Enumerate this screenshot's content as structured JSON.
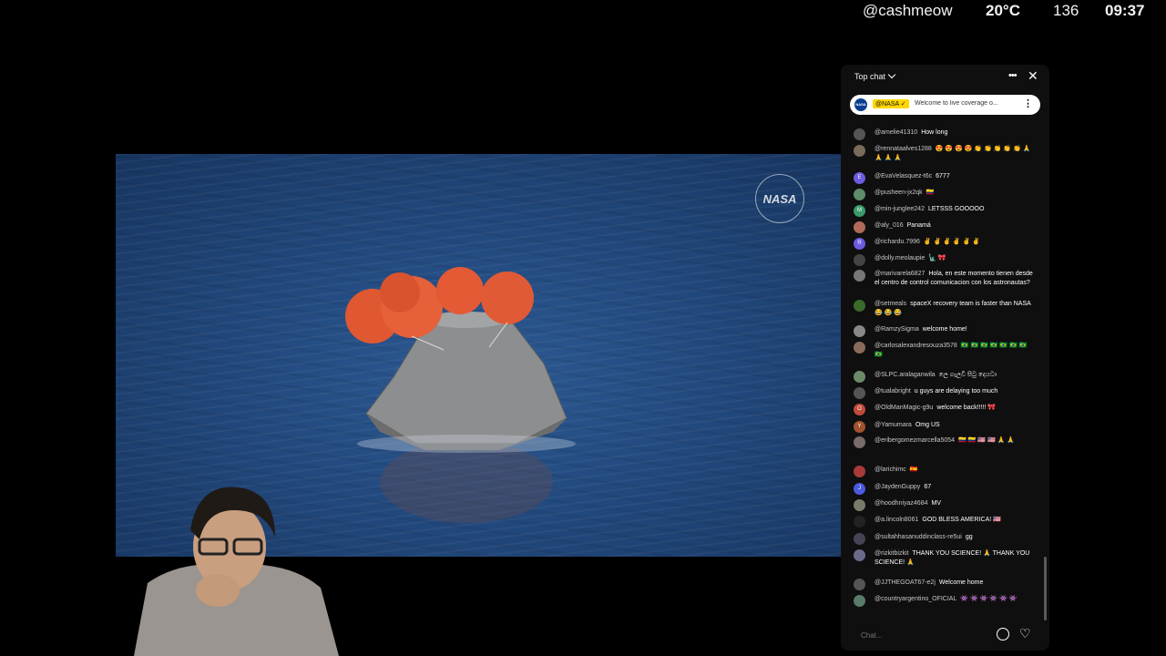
{
  "overlay": {
    "handle": "@cashmeow",
    "temperature": "20°C",
    "count": "136",
    "time": "09:37"
  },
  "video": {
    "logo": "NASA"
  },
  "chat": {
    "title": "Top chat",
    "pinned": {
      "author": "@NASA ✓",
      "text": "Welcome to live coverage o..."
    },
    "input_placeholder": "Chat...",
    "messages": [
      {
        "author": "@amelie41310",
        "text": "How long",
        "avatar": ""
      },
      {
        "author": "@rennataalves1288",
        "text": "😍 😍 😍 😍 👏 👏 👏 👏 👏 🙏 🙏 🙏 🙏",
        "avatar": ""
      },
      {
        "author": "@EvaVelasquez-t6c",
        "text": "6777",
        "avatar": "E"
      },
      {
        "author": "@pusheen-jx2qk",
        "text": "🇨🇴",
        "avatar": ""
      },
      {
        "author": "@min-junglee242",
        "text": "LETSSS GOOOOO",
        "avatar": "M"
      },
      {
        "author": "@aly_016",
        "text": "Panamá",
        "avatar": ""
      },
      {
        "author": "@richardu.7996",
        "text": "✌ ✌ ✌ ✌ ✌ ✌",
        "avatar": "R"
      },
      {
        "author": "@dolly.meolaupie",
        "text": "🗽 🎀",
        "avatar": ""
      },
      {
        "author": "@marivarela6827",
        "text": "Hola, en este momento tienen desde el centro de control comunicacion con los astronautas?",
        "avatar": ""
      },
      {
        "author": "@setmeals",
        "text": "spaceX recovery team is faster than NASA 😂 😂 😂",
        "avatar": ""
      },
      {
        "author": "@RamzySigma",
        "text": "welcome home!",
        "avatar": ""
      },
      {
        "author": "@carlosalexandresouza3578",
        "text": "🇧🇷 🇧🇷 🇧🇷 🇧🇷 🇧🇷 🇧🇷 🇧🇷 🇧🇷",
        "avatar": ""
      },
      {
        "author": "@SLPC.aralaganwila",
        "text": "ලෙ ගැලවී සිටු දෙයටා",
        "avatar": ""
      },
      {
        "author": "@tualabright",
        "text": "u guys are delaying too much",
        "avatar": ""
      },
      {
        "author": "@OldManMagic-g9u",
        "text": "welcome back!!!!! 🎀",
        "avatar": "O"
      },
      {
        "author": "@Yamumara",
        "text": "Omg US",
        "avatar": "Y"
      },
      {
        "author": "@eribergomezmarcella5054",
        "text": "🇨🇴 🇨🇴 🇺🇸 🇺🇸 🙏 🙏",
        "avatar": ""
      },
      {
        "author": "@larichimc",
        "text": "🇪🇸",
        "avatar": ""
      },
      {
        "author": "@JaydenGuppy",
        "text": "67",
        "avatar": "J"
      },
      {
        "author": "@hoodhniyaz4684",
        "text": "MV",
        "avatar": ""
      },
      {
        "author": "@a.lincoln8061",
        "text": "GOD BLESS AMERICA! 🇺🇸",
        "avatar": ""
      },
      {
        "author": "@sultahhasanuddinclass-re5ui",
        "text": "gg",
        "avatar": ""
      },
      {
        "author": "@rizkitbizkit",
        "text": "THANK YOU SCIENCE! 🙏 THANK YOU SCIENCE! 🙏",
        "avatar": ""
      },
      {
        "author": "@JJTHEGOAT67-e2j",
        "text": "Welcome home",
        "avatar": ""
      },
      {
        "author": "@countryargentino_OFICIAL",
        "text": "👾 👾 👾 👾 👾 👾",
        "avatar": ""
      }
    ]
  }
}
